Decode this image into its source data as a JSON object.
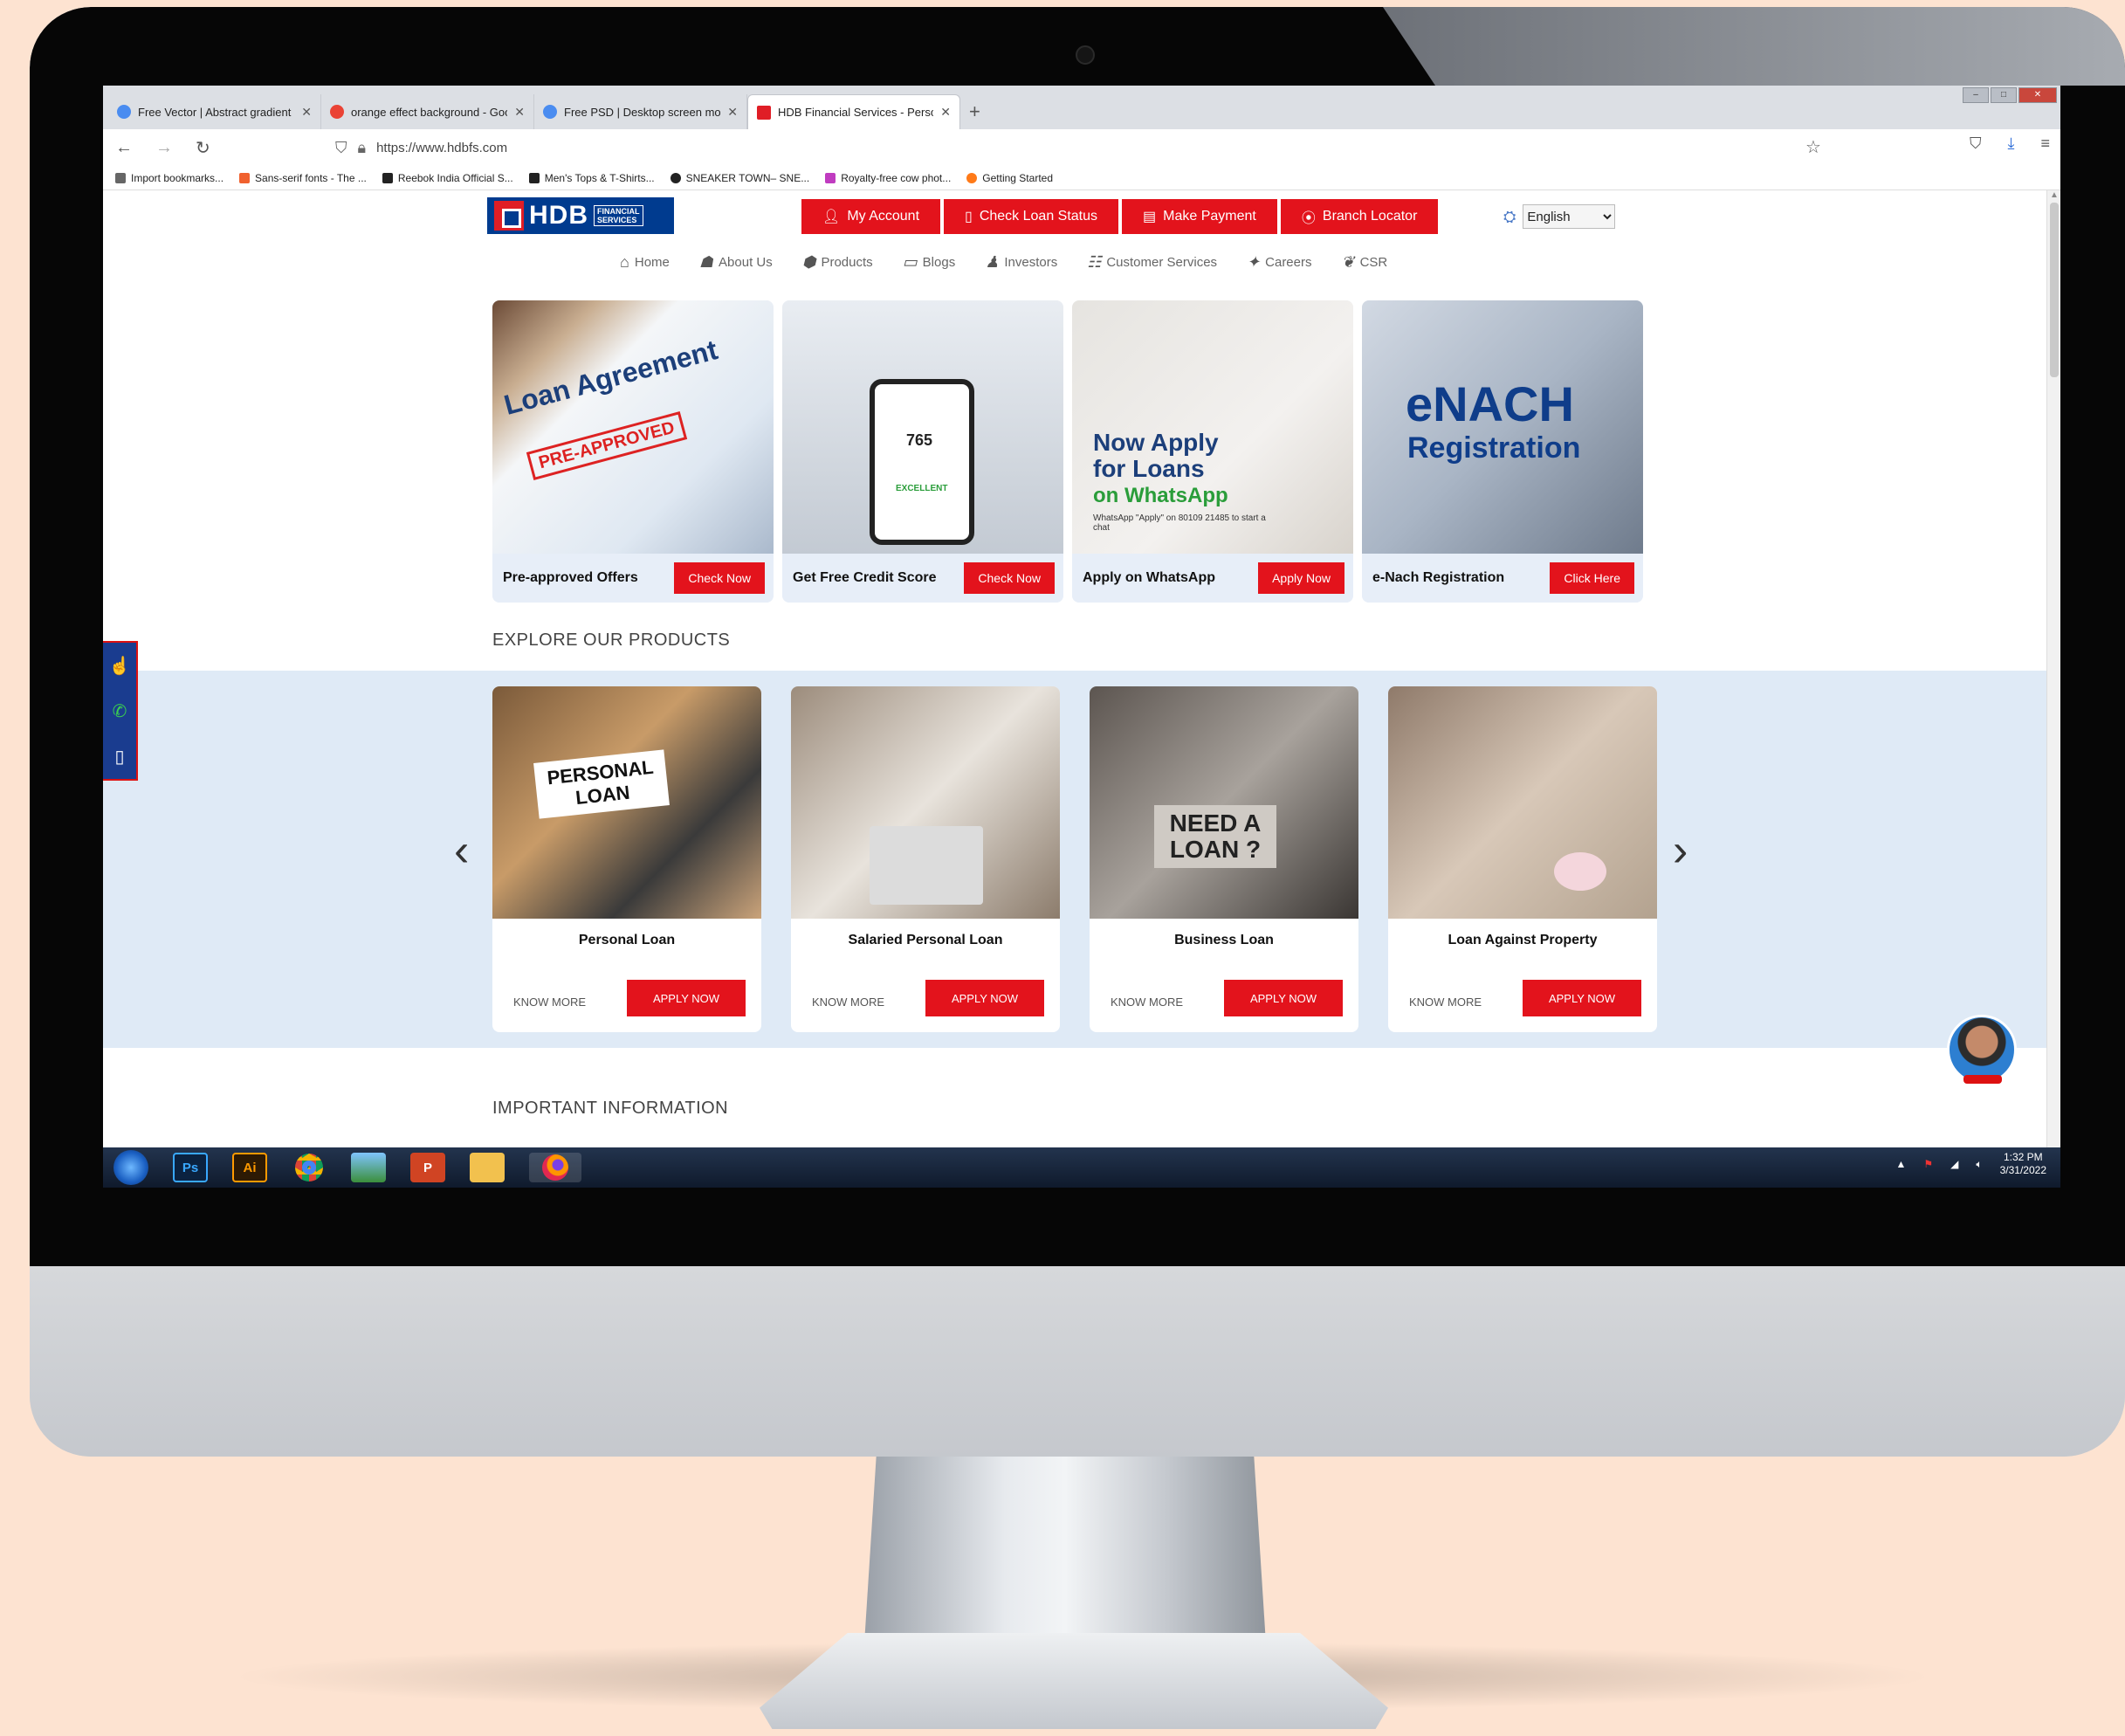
{
  "browser": {
    "tabs": [
      {
        "label": "Free Vector | Abstract gradient",
        "favicon_color": "#4a8cf0",
        "active": false
      },
      {
        "label": "orange effect background - Goo",
        "favicon_color": "#ea4335",
        "active": false
      },
      {
        "label": "Free PSD | Desktop screen moc",
        "favicon_color": "#4a8cf0",
        "active": false
      },
      {
        "label": "HDB Financial Services - Person",
        "favicon_color": "#e01e26",
        "active": true
      }
    ],
    "new_tab": "+",
    "url": "https://www.hdbfs.com",
    "bookmarks": [
      {
        "label": "Import bookmarks...",
        "color": "#666666"
      },
      {
        "label": "Sans-serif fonts - The ...",
        "color": "#f0612e"
      },
      {
        "label": "Reebok India Official S...",
        "color": "#222222"
      },
      {
        "label": "Men's Tops & T-Shirts...",
        "color": "#222222"
      },
      {
        "label": "SNEAKER TOWN– SNE...",
        "color": "#222222"
      },
      {
        "label": "Royalty-free cow phot...",
        "color": "#c03cc0"
      },
      {
        "label": "Getting Started",
        "color": "#ff7a18"
      }
    ]
  },
  "header": {
    "logo_text": "HDB",
    "logo_sub1": "FINANCIAL",
    "logo_sub2": "SERVICES",
    "buttons": [
      "My Account",
      "Check Loan Status",
      "Make Payment",
      "Branch Locator"
    ],
    "language": "English"
  },
  "nav": [
    "Home",
    "About Us",
    "Products",
    "Blogs",
    "Investors",
    "Customer Services",
    "Careers",
    "CSR"
  ],
  "banners": [
    {
      "label": "Pre-approved Offers",
      "button": "Check Now",
      "art": "Loan Agreement",
      "stamp": "PRE-APPROVED"
    },
    {
      "label": "Get Free Credit Score",
      "button": "Check Now",
      "art": "765",
      "art2": "EXCELLENT"
    },
    {
      "label": "Apply on WhatsApp",
      "button": "Apply Now",
      "art": "Now Apply for Loans",
      "art2": "on WhatsApp",
      "art3": "WhatsApp \"Apply\" on 80109 21485 to start a chat"
    },
    {
      "label": "e-Nach Registration",
      "button": "Click Here",
      "art": "eNACH",
      "art2": "Registration"
    }
  ],
  "explore": {
    "title": "EXPLORE OUR PRODUCTS",
    "products": [
      {
        "title": "Personal Loan",
        "know_more": "KNOW MORE",
        "apply": "APPLY NOW",
        "art": "PERSONAL LOAN"
      },
      {
        "title": "Salaried Personal Loan",
        "know_more": "KNOW MORE",
        "apply": "APPLY NOW",
        "art": ""
      },
      {
        "title": "Business Loan",
        "know_more": "KNOW MORE",
        "apply": "APPLY NOW",
        "art": "NEED A LOAN ?"
      },
      {
        "title": "Loan Against Property",
        "know_more": "KNOW MORE",
        "apply": "APPLY NOW",
        "art": ""
      }
    ]
  },
  "info_title": "IMPORTANT INFORMATION",
  "taskbar": {
    "apps": [
      "Ps",
      "Ai",
      "Chrome",
      "Photos",
      "PowerPoint",
      "Files",
      "Firefox"
    ],
    "time": "1:32 PM",
    "date": "3/31/2022"
  },
  "colors": {
    "brand_red": "#e3131c",
    "brand_blue": "#003b8f",
    "explore_bg": "#dfeaf6"
  }
}
